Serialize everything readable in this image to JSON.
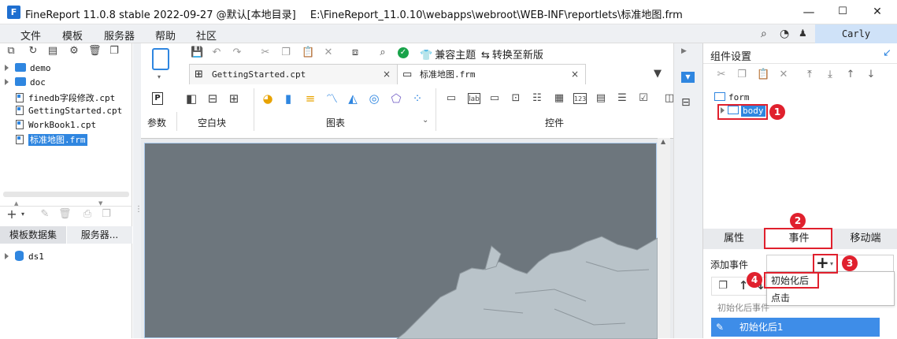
{
  "titlebar": {
    "app_title": "FineReport 11.0.8 stable 2022-09-27 @默认[本地目录]",
    "file_path": "E:\\FineReport_11.0.10\\webapps\\webroot\\WEB-INF\\reportlets\\标准地图.frm",
    "minimize": "—",
    "maximize": "☐",
    "close": "✕"
  },
  "menubar": {
    "items": [
      "文件",
      "模板",
      "服务器",
      "帮助",
      "社区"
    ],
    "user": "Carly"
  },
  "file_tree": {
    "items": [
      "demo",
      "doc",
      "finedb字段修改.cpt",
      "GettingStarted.cpt",
      "WorkBook1.cpt",
      "标准地图.frm"
    ],
    "selected": "标准地图.frm"
  },
  "datasets": {
    "tabs": [
      "模板数据集",
      "服务器..."
    ],
    "items": [
      "ds1"
    ]
  },
  "editor": {
    "toolbar_labels": {
      "theme": "兼容主题",
      "convert": "转换至新版"
    },
    "tabs": [
      {
        "label": "GettingStarted.cpt",
        "close": "×"
      },
      {
        "label": "标准地图.frm",
        "close": "×"
      }
    ],
    "groups": [
      "参数",
      "空白块",
      "图表",
      "控件"
    ],
    "param_icon": "P"
  },
  "component_settings": {
    "title": "组件设置",
    "tree": [
      "form",
      "body"
    ],
    "property_tabs": [
      "属性",
      "事件",
      "移动端"
    ],
    "active_tab": "事件",
    "add_event_label": "添加事件",
    "add_button": "+",
    "dropdown_options": [
      "初始化后",
      "点击"
    ],
    "event_section_label": "初始化后事件",
    "event_item": "初始化后1"
  },
  "annotations": [
    "1",
    "2",
    "3",
    "4"
  ],
  "colors": {
    "accent": "#2f86e0",
    "annotation_red": "#e0202d",
    "selected_event": "#3e8de8",
    "map_background": "#6d767d",
    "map_land": "#b9c3c9"
  }
}
